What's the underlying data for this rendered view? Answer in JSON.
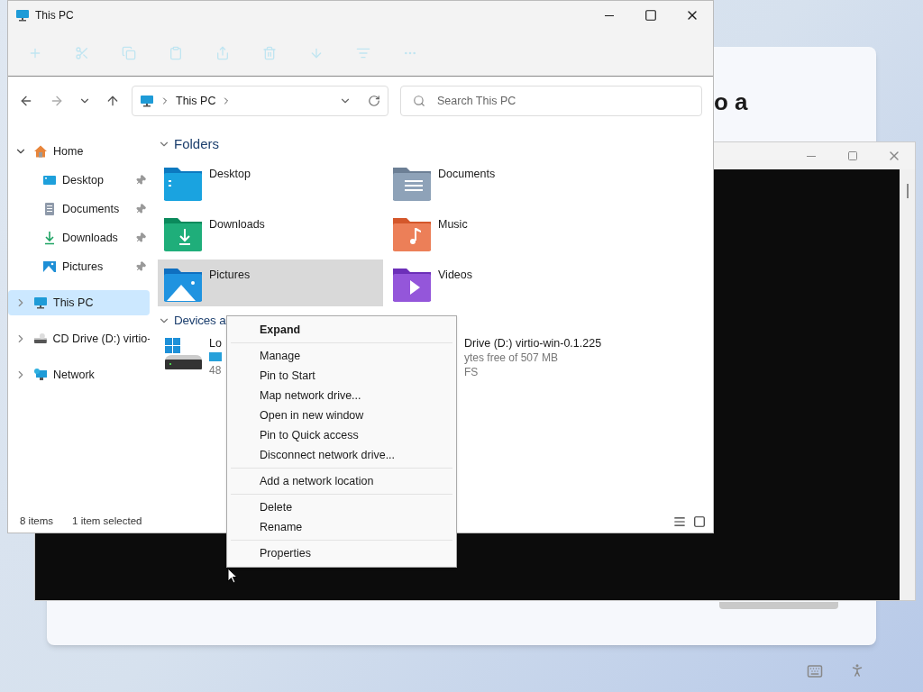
{
  "setup": {
    "heading": "o a"
  },
  "explorer": {
    "title": "This PC",
    "address": {
      "crumb": "This PC"
    },
    "search": {
      "placeholder": "Search This PC"
    },
    "sidebar": [
      {
        "label": "Home",
        "kind": "home",
        "expanded": true,
        "selected": false,
        "children": [
          {
            "label": "Desktop",
            "kind": "desktop",
            "pinned": true,
            "selected": false
          },
          {
            "label": "Documents",
            "kind": "documents",
            "pinned": true,
            "selected": false
          },
          {
            "label": "Downloads",
            "kind": "downloads",
            "pinned": true,
            "selected": false
          },
          {
            "label": "Pictures",
            "kind": "pictures",
            "pinned": true,
            "selected": false
          }
        ]
      },
      {
        "label": "This PC",
        "kind": "pc",
        "expanded": false,
        "selected": true
      },
      {
        "label": "CD Drive (D:) virtio-",
        "kind": "cd",
        "expanded": false,
        "selected": false
      },
      {
        "label": "Network",
        "kind": "network",
        "expanded": false,
        "selected": false
      }
    ],
    "folders_header": "Folders",
    "folders": [
      {
        "name": "Desktop",
        "kind": "desktop",
        "selected": false
      },
      {
        "name": "Documents",
        "kind": "documents",
        "selected": false
      },
      {
        "name": "Downloads",
        "kind": "downloads",
        "selected": false
      },
      {
        "name": "Music",
        "kind": "music",
        "selected": false
      },
      {
        "name": "Pictures",
        "kind": "pictures",
        "selected": true
      },
      {
        "name": "Videos",
        "kind": "videos",
        "selected": false
      }
    ],
    "devices_header": "Devices a",
    "drives": [
      {
        "kind": "system",
        "name": "Lo",
        "detail": "48"
      },
      {
        "kind": "cd",
        "name": "Drive (D:) virtio-win-0.1.225",
        "detail": "ytes free of 507 MB",
        "filesystem": "FS"
      }
    ],
    "status": {
      "count": "8 items",
      "selection": "1 item selected"
    }
  },
  "context_menu": {
    "groups": [
      [
        {
          "label": "Expand",
          "bold": true
        }
      ],
      [
        {
          "label": "Manage",
          "bold": false
        },
        {
          "label": "Pin to Start",
          "bold": false
        },
        {
          "label": "Map network drive...",
          "bold": false
        },
        {
          "label": "Open in new window",
          "bold": false
        },
        {
          "label": "Pin to Quick access",
          "bold": false
        },
        {
          "label": "Disconnect network drive...",
          "bold": false
        }
      ],
      [
        {
          "label": "Add a network location",
          "bold": false
        }
      ],
      [
        {
          "label": "Delete",
          "bold": false
        },
        {
          "label": "Rename",
          "bold": false
        }
      ],
      [
        {
          "label": "Properties",
          "bold": false
        }
      ]
    ]
  }
}
